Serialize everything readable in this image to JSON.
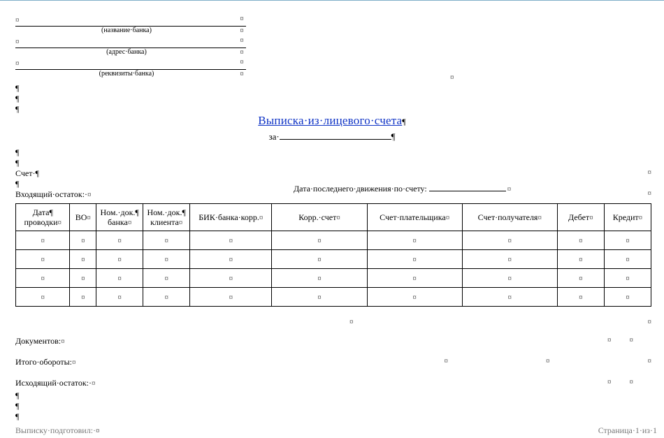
{
  "marks": {
    "cell": "¤",
    "para": "¶",
    "dot": "·"
  },
  "bank": {
    "caption_name": "(название·банка)",
    "caption_addr": "(адрес·банка)",
    "caption_req": "(реквизиты·банка)"
  },
  "title": {
    "main": "Выписка·из·лицевого·счета",
    "za": "за·"
  },
  "labels": {
    "schet": "Счет·",
    "incoming": "Входящий·остаток:·",
    "lastmove": "Дата·последнего·движения·по·счету:",
    "docs": "Документов:",
    "turns": "Итого·обороты:",
    "outgoing": "Исходящий·остаток:·",
    "prepared": "Выписку·подготовил:·",
    "pagenum": "Страница·1·из·1"
  },
  "table": {
    "headers": [
      "Дата¶\nпроводки",
      "ВО",
      "Ном.·док.¶\nбанка",
      "Ном.·док.¶\nклиента",
      "БИК·банка·корр.",
      "Корр.·счет",
      "Счет·плательщика",
      "Счет·получателя",
      "Дебет",
      "Кредит"
    ],
    "rows": 4,
    "cols": 10
  },
  "chart_data": {
    "type": "table",
    "title": "Выписка из лицевого счета",
    "columns": [
      "Дата проводки",
      "ВО",
      "Ном. док. банка",
      "Ном. док. клиента",
      "БИК банка корр.",
      "Корр. счет",
      "Счет плательщика",
      "Счет получателя",
      "Дебет",
      "Кредит"
    ],
    "rows": [
      [
        "",
        "",
        "",
        "",
        "",
        "",
        "",
        "",
        "",
        ""
      ],
      [
        "",
        "",
        "",
        "",
        "",
        "",
        "",
        "",
        "",
        ""
      ],
      [
        "",
        "",
        "",
        "",
        "",
        "",
        "",
        "",
        "",
        ""
      ],
      [
        "",
        "",
        "",
        "",
        "",
        "",
        "",
        "",
        "",
        ""
      ]
    ]
  }
}
